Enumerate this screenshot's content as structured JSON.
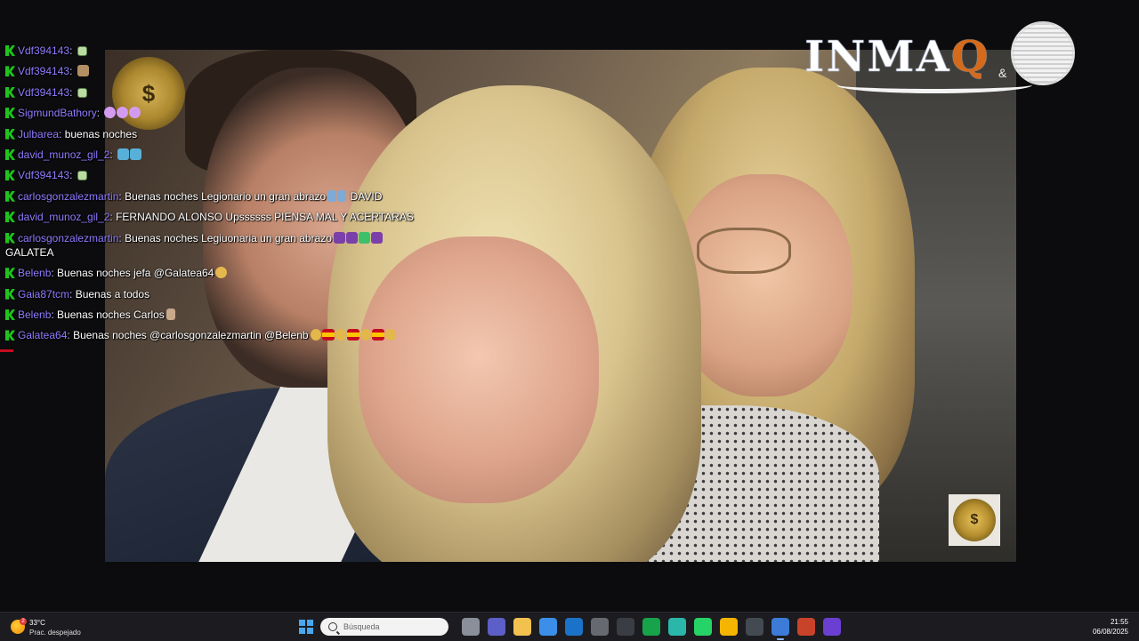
{
  "chat": [
    {
      "user": "Vdf394143",
      "text": "",
      "emotes": "e-green",
      "count": 1
    },
    {
      "user": "Vdf394143",
      "text": "",
      "emotes": "e-face",
      "count": 1
    },
    {
      "user": "Vdf394143",
      "text": "",
      "emotes": "e-green",
      "count": 1
    },
    {
      "user": "SigmundBathory",
      "text": "",
      "emotes": "e-skull",
      "count": 3
    },
    {
      "user": "Julbarea",
      "text": "buenas noches",
      "emotes": "",
      "count": 0
    },
    {
      "user": "david_munoz_gil_2",
      "text": "",
      "emotes": "e-paint",
      "count": 2
    },
    {
      "user": "Vdf394143",
      "text": "",
      "emotes": "e-green",
      "count": 1
    },
    {
      "user": "carlosgonzalezmartin",
      "text": "Buenas noches Legionario un gran abrazo",
      "emotes": "e-blue",
      "count": 2,
      "tail": "DAVID"
    },
    {
      "user": "david_munoz_gil_2",
      "text": "FERNANDO ALONSO Upssssss PIENSA MAL Y ACERTARAS",
      "emotes": "",
      "count": 0
    },
    {
      "user": "carlosgonzalezmartin",
      "text": "Buenas noches Legiuonaria un gran abrazo",
      "emotes": "e-alien",
      "count": 4,
      "wrap": "GALATEA"
    },
    {
      "user": "Belenb",
      "text": "Buenas noches jefa @Galatea64",
      "emotes": "e-kiss",
      "count": 1
    },
    {
      "user": "Gaia87tcm",
      "text": "Buenas a todos",
      "emotes": "",
      "count": 0
    },
    {
      "user": "Belenb",
      "text": "Buenas noches Carlos",
      "emotes": "e-hand",
      "count": 1
    },
    {
      "user": "Galatea64",
      "text": "Buenas noches @carlosgonzalezmartin @Belenb",
      "emotes": "e-spain",
      "count": 7
    }
  ],
  "overlay": {
    "brand_main": "INMA",
    "brand_q": "Q",
    "brand_amp": "&",
    "coin_symbol": "$"
  },
  "taskbar": {
    "temperature": "33°C",
    "weather_desc": "Prac. despejado",
    "weather_badge": "2",
    "search_placeholder": "Búsqueda",
    "time": "21:55",
    "date": "06/08/2025",
    "apps": [
      {
        "name": "task-view-icon",
        "color": "#8a8f99"
      },
      {
        "name": "teams-icon",
        "color": "#5b5fc7"
      },
      {
        "name": "file-explorer-icon",
        "color": "#f2c14e"
      },
      {
        "name": "ms-store-icon",
        "color": "#3b8fe8"
      },
      {
        "name": "outlook-icon",
        "color": "#1a73c8"
      },
      {
        "name": "app-recorder-icon",
        "color": "#666a70"
      },
      {
        "name": "obs-icon",
        "color": "#3a3d44"
      },
      {
        "name": "camtasia-icon",
        "color": "#16a34a"
      },
      {
        "name": "edge-icon",
        "color": "#2ab7a9"
      },
      {
        "name": "whatsapp-icon",
        "color": "#25d366"
      },
      {
        "name": "chrome-icon",
        "color": "#f4b400"
      },
      {
        "name": "vpn-icon",
        "color": "#444a52"
      },
      {
        "name": "stream-app-icon",
        "color": "#3d7bd9"
      },
      {
        "name": "powerpoint-icon",
        "color": "#c8432a"
      },
      {
        "name": "media-app-icon",
        "color": "#6a3fd1"
      }
    ]
  },
  "colors": {
    "username": "#8f7cff",
    "badge": "#20c31e",
    "taskbar_bg": "#1c1c20"
  }
}
